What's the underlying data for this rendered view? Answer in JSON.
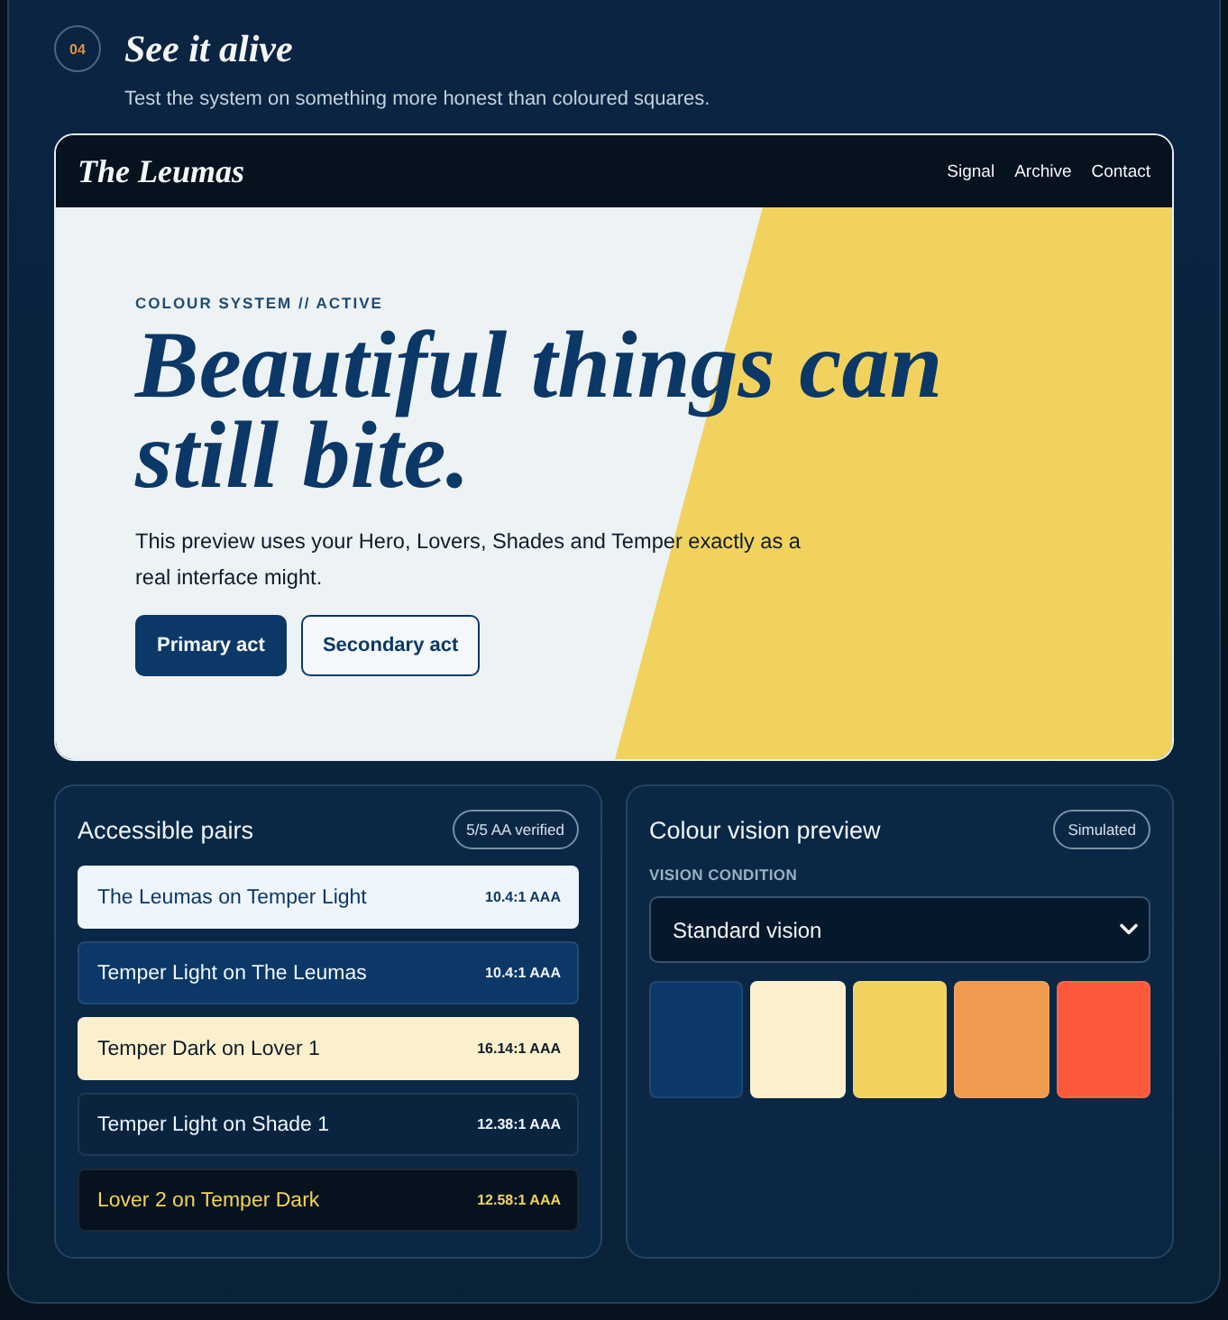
{
  "section": {
    "number": "04",
    "title": "See it alive",
    "subtitle": "Test the system on something more honest than coloured squares."
  },
  "preview": {
    "logo": "The Leumas",
    "nav": [
      "Signal",
      "Archive",
      "Contact"
    ],
    "eyebrow": "COLOUR SYSTEM // ACTIVE",
    "headline": "Beautiful things can still bite.",
    "body": "This preview uses your Hero, Lovers, Shades and Temper exactly as a real interface might.",
    "buttons": [
      {
        "label": "Primary act",
        "kind": "primary"
      },
      {
        "label": "Secondary act",
        "kind": "secondary"
      }
    ]
  },
  "pairs_panel": {
    "title": "Accessible pairs",
    "badge": "5/5 AA verified",
    "pairs": [
      {
        "label": "The Leumas on Temper Light",
        "ratio": "10.4:1 AAA",
        "color": "#eef5fd",
        "foreground": {
          "color": "#0b3866"
        }
      },
      {
        "label": "Temper Light on The Leumas",
        "ratio": "10.4:1 AAA",
        "color": "#0b3866",
        "foreground": {
          "color": "#eef5fd"
        }
      },
      {
        "label": "Temper Dark on Lover 1",
        "ratio": "16.14:1 AAA",
        "color": "#fbf0cb",
        "foreground": {
          "color": "#0b1a2a"
        }
      },
      {
        "label": "Temper Light on Shade 1",
        "ratio": "12.38:1 AAA",
        "color": "#0a2440",
        "foreground": {
          "color": "#eef5fd"
        }
      },
      {
        "label": "Lover 2 on Temper Dark",
        "ratio": "12.58:1 AAA",
        "color": "#06121e",
        "foreground": {
          "color": "#f2d25e"
        }
      }
    ]
  },
  "vision_panel": {
    "title": "Colour vision preview",
    "badge": "Simulated",
    "field_label": "VISION CONDITION",
    "condition": "Standard vision",
    "swatches": [
      {
        "color": "#0b3866"
      },
      {
        "color": "#fbf0cb"
      },
      {
        "color": "#f2d25e"
      },
      {
        "color": "#ef9a4e"
      },
      {
        "color": "#fd583a"
      }
    ]
  }
}
